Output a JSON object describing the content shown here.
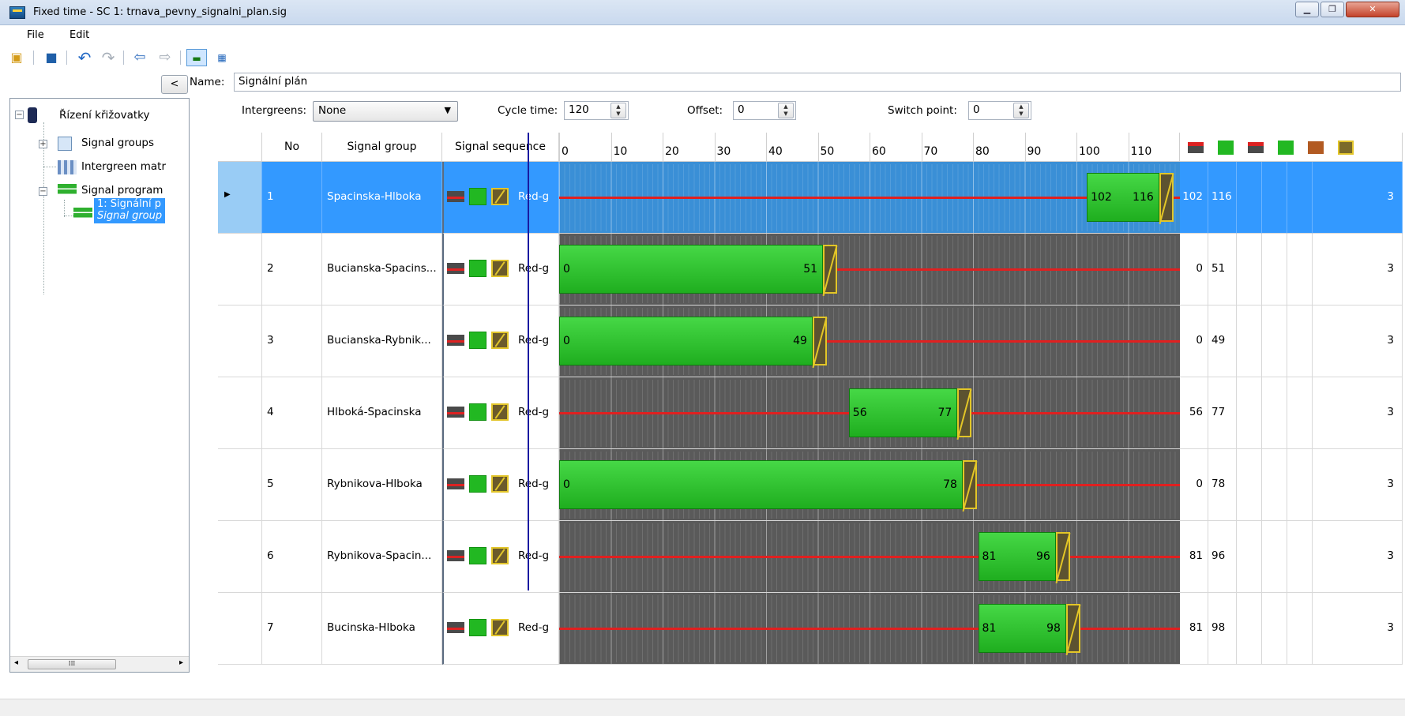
{
  "window": {
    "title": "Fixed time - SC 1: trnava_pevny_signalni_plan.sig"
  },
  "menu": [
    "File",
    "Edit"
  ],
  "tree": {
    "root": "Řízení křižovatky",
    "signal_groups": "Signal groups",
    "intergreen": "Intergreen matr",
    "signal_program": "Signal program",
    "selected_line1": "1: Signální p",
    "selected_line2": "Signal group"
  },
  "form": {
    "name_label": "Name:",
    "name_value": "Signální plán",
    "intergreens_label": "Intergreens:",
    "intergreens_value": "None",
    "cycle_label": "Cycle time:",
    "cycle_value": "120",
    "offset_label": "Offset:",
    "offset_value": "0",
    "switch_label": "Switch point:",
    "switch_value": "0"
  },
  "grid": {
    "headers": {
      "no": "No",
      "group": "Signal group",
      "sequence": "Signal sequence"
    },
    "scale": [
      "0",
      "10",
      "20",
      "30",
      "40",
      "50",
      "60",
      "70",
      "80",
      "90",
      "100",
      "110"
    ],
    "rows": [
      {
        "no": "1",
        "group": "Spacinska-Hlboka",
        "seq": "Red-g",
        "start": 102,
        "end": 116,
        "amber": 3,
        "c1": "102",
        "c2": "116",
        "c3": "3"
      },
      {
        "no": "2",
        "group": "Bucianska-Spacins...",
        "seq": "Red-g",
        "start": 0,
        "end": 51,
        "amber": 3,
        "c1": "0",
        "c2": "51",
        "c3": "3"
      },
      {
        "no": "3",
        "group": "Bucianska-Rybnik...",
        "seq": "Red-g",
        "start": 0,
        "end": 49,
        "amber": 3,
        "c1": "0",
        "c2": "49",
        "c3": "3"
      },
      {
        "no": "4",
        "group": "Hlboká-Spacinska",
        "seq": "Red-g",
        "start": 56,
        "end": 77,
        "amber": 3,
        "c1": "56",
        "c2": "77",
        "c3": "3"
      },
      {
        "no": "5",
        "group": "Rybnikova-Hlboka",
        "seq": "Red-g",
        "start": 0,
        "end": 78,
        "amber": 3,
        "c1": "0",
        "c2": "78",
        "c3": "3"
      },
      {
        "no": "6",
        "group": "Rybnikova-Spacin...",
        "seq": "Red-g",
        "start": 81,
        "end": 96,
        "amber": 3,
        "c1": "81",
        "c2": "96",
        "c3": "3"
      },
      {
        "no": "7",
        "group": "Bucinska-Hlboka",
        "seq": "Red-g",
        "start": 81,
        "end": 98,
        "amber": 3,
        "c1": "81",
        "c2": "98",
        "c3": "3"
      }
    ]
  },
  "colors": {
    "selection": "#3399ff",
    "green": "#22b822",
    "red": "#e02020",
    "amber": "#e3c627",
    "timeline_bg": "#5a5a5a"
  },
  "icons": [
    "save-icon",
    "undo-icon",
    "redo-icon",
    "back-icon",
    "forward-icon",
    "graphic-view-icon",
    "table-view-icon"
  ]
}
